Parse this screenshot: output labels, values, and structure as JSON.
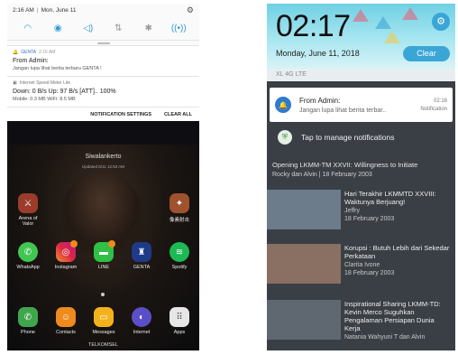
{
  "left": {
    "status": {
      "time": "2:16 AM",
      "date": "Mon, June 11"
    },
    "quick_settings": [
      "wifi",
      "location",
      "sound",
      "data",
      "bluetooth",
      "nfc"
    ],
    "notif1": {
      "app": "GENTA",
      "time": "2:16 AM",
      "title": "From Admin:",
      "body": "Jangan lupa lihat berita terbaru GENTA !"
    },
    "notif2": {
      "app": "Internet Speed Meter Lite",
      "title": "Down: 0 B/s   Up: 97 B/s   [ATT]..  100%",
      "body": "Mobile: 0.3 MB   WiFi: 8.5 MB"
    },
    "actions": {
      "settings": "NOTIFICATION SETTINGS",
      "clear": "CLEAR ALL"
    },
    "lock": {
      "name": "Siwalankerto",
      "updated": "Updated 6/11 12:53 AM"
    },
    "apps": {
      "arena": "Arena of Valor",
      "game2": "像素射击",
      "whatsapp": "WhatsApp",
      "instagram": "Instagram",
      "line": "LINE",
      "genta": "GENTA",
      "spotify": "Spotify",
      "phone": "Phone",
      "contacts": "Contacts",
      "messages": "Messages",
      "internet": "Internet",
      "apps": "Apps"
    },
    "carrier": "TELKOMSEL"
  },
  "right": {
    "clock": "02:17",
    "date": "Monday, June 11, 2018",
    "clear": "Clear",
    "network": "XL 4G LTE",
    "notif": {
      "title": "From Admin:",
      "body": "Jangan lupa lihat berita terbar..",
      "time": "02:16",
      "label": "Notification"
    },
    "manage": "Tap to manage notifications",
    "featured": {
      "title": "Opening LKMM-TM XXVII: Willingness to Initiate",
      "meta": "Rocky dan Alvin  |  18 February 2003"
    },
    "articles": [
      {
        "title": "Hari Terakhir LKMMTD XXVIII: Waktunya Berjuang!",
        "author": "Jeffry",
        "date": "18 February 2003"
      },
      {
        "title": "Korupsi : Butuh Lebih dari Sekedar Perkataan",
        "author": "Clarita Ivone",
        "date": "18 February 2003"
      },
      {
        "title": "Inspirational Sharing LKMM-TD: Kevin Merco Suguhkan Pengalaman Persiapan Dunia Kerja",
        "author": "Natania Wahyuni T dan Alvin",
        "date": ""
      }
    ]
  },
  "colors": {
    "accent": "#3aa6d6",
    "notif_icon": "#2e7bd0",
    "shield": "#3b8a46"
  }
}
